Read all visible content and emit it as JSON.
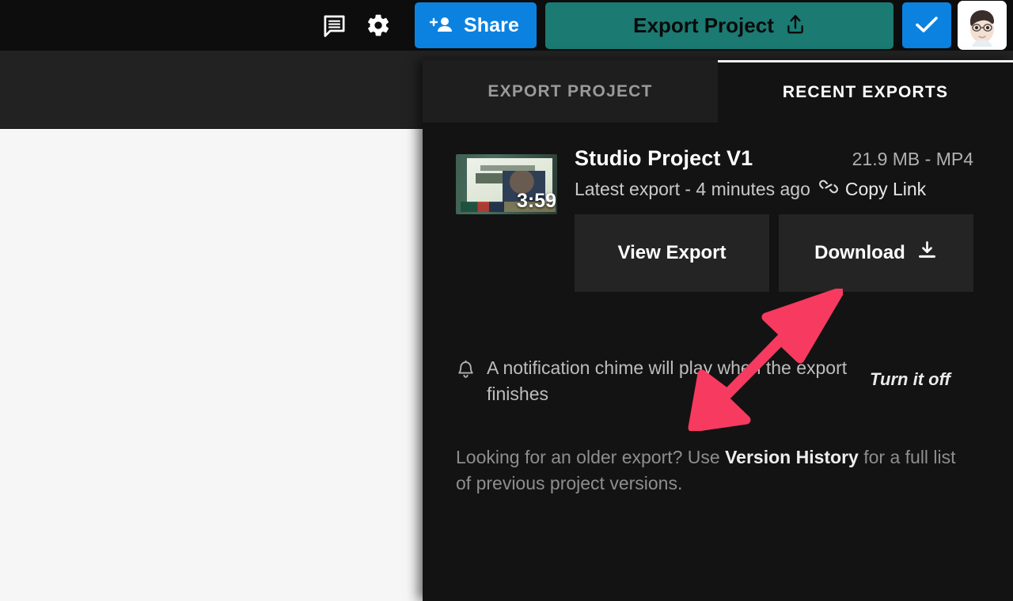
{
  "topbar": {
    "comment_icon": "comment-icon",
    "settings_icon": "gear-icon",
    "share_label": "Share",
    "share_icon": "add-person-icon",
    "share_color": "#0b82e0",
    "export_label": "Export Project",
    "export_icon": "upload-icon",
    "export_color": "#1b7a72",
    "confirm_icon": "check-icon",
    "confirm_color": "#0b82e0",
    "avatar_icon": "avatar"
  },
  "panel": {
    "tabs": [
      {
        "label": "EXPORT PROJECT",
        "active": false
      },
      {
        "label": "RECENT EXPORTS",
        "active": true
      }
    ],
    "export": {
      "thumbnail_duration": "3:59",
      "title": "Studio Project V1",
      "size": "21.9 MB - MP4",
      "status": "Latest export - 4 minutes ago",
      "copy_link_label": "Copy Link",
      "copy_link_icon": "link-icon",
      "actions": [
        {
          "label": "View Export",
          "icon": null
        },
        {
          "label": "Download",
          "icon": "download-icon"
        }
      ]
    },
    "notification": {
      "icon": "bell-icon",
      "text": "A notification chime will play when the export finishes",
      "turn_off_label": "Turn it off"
    },
    "older": {
      "prefix": "Looking for an older export? Use ",
      "link": "Version History",
      "suffix": " for a full list of previous project versions."
    }
  },
  "annotation": {
    "arrow_color": "#f73a5f",
    "arrow_name": "pointer-arrow"
  }
}
